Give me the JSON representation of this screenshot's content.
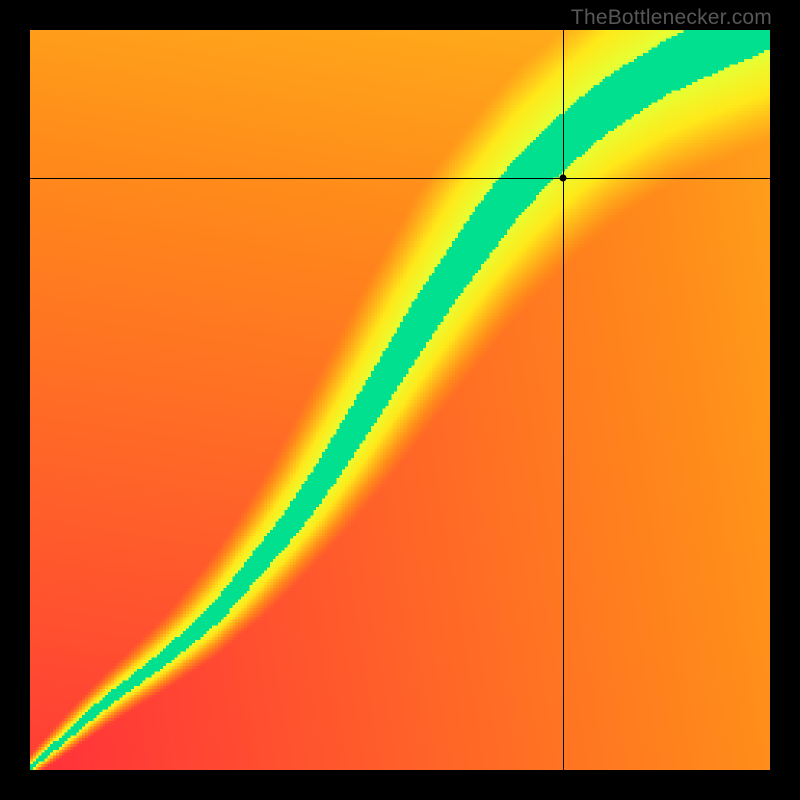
{
  "watermark": "TheBottlenecker.com",
  "chart_data": {
    "type": "heatmap",
    "title": "",
    "xlabel": "",
    "ylabel": "",
    "xlim": [
      0,
      1
    ],
    "ylim": [
      0,
      1
    ],
    "grid": false,
    "legend": false,
    "colormap": {
      "name": "red-yellow-green",
      "stops": [
        {
          "t": 0.0,
          "color": "#ff1e41"
        },
        {
          "t": 0.35,
          "color": "#ff8a1a"
        },
        {
          "t": 0.6,
          "color": "#ffe81a"
        },
        {
          "t": 0.82,
          "color": "#e6ff33"
        },
        {
          "t": 0.94,
          "color": "#7fff66"
        },
        {
          "t": 1.0,
          "color": "#00e08f"
        }
      ]
    },
    "green_curve": {
      "description": "Approximate (x,y) fractions along the green ridge, origin at bottom-left",
      "points": [
        [
          0.02,
          0.02
        ],
        [
          0.1,
          0.09
        ],
        [
          0.18,
          0.15
        ],
        [
          0.25,
          0.21
        ],
        [
          0.3,
          0.27
        ],
        [
          0.35,
          0.33
        ],
        [
          0.4,
          0.4
        ],
        [
          0.45,
          0.48
        ],
        [
          0.5,
          0.56
        ],
        [
          0.55,
          0.64
        ],
        [
          0.6,
          0.71
        ],
        [
          0.65,
          0.78
        ],
        [
          0.71,
          0.84
        ],
        [
          0.78,
          0.9
        ],
        [
          0.86,
          0.95
        ],
        [
          0.95,
          0.99
        ]
      ],
      "half_width_frac": 0.06
    },
    "crosshair": {
      "x": 0.72,
      "y": 0.8
    },
    "resolution": 256
  }
}
